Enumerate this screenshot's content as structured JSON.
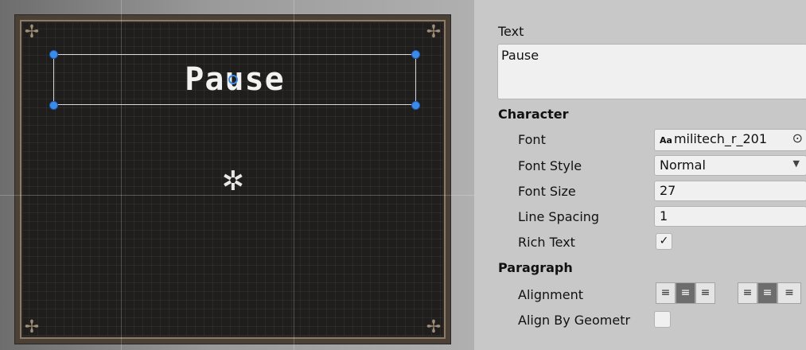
{
  "scene": {
    "label_text": "Pause",
    "anchor_glyph": "✲",
    "corner_glyph": "✢"
  },
  "inspector": {
    "text_label": "Text",
    "text_value": "Pause",
    "character_header": "Character",
    "font_label": "Font",
    "font_value": "militech_r_201",
    "font_icon_text": "Aa",
    "font_style_label": "Font Style",
    "font_style_value": "Normal",
    "font_size_label": "Font Size",
    "font_size_value": "27",
    "line_spacing_label": "Line Spacing",
    "line_spacing_value": "1",
    "rich_text_label": "Rich Text",
    "rich_text_checked": true,
    "paragraph_header": "Paragraph",
    "alignment_label": "Alignment",
    "horizontal_alignment": "center",
    "vertical_alignment": "middle",
    "align_by_geometry_label": "Align By Geometr",
    "align_by_geometry_checked": false
  },
  "icons": {
    "dropdown": "▼",
    "object_picker": "⊙",
    "check": "✓"
  },
  "colors": {
    "handle_blue": "#3d8be8",
    "inspector_bg": "#c8c8c8",
    "active_button": "#6d6d6d"
  }
}
